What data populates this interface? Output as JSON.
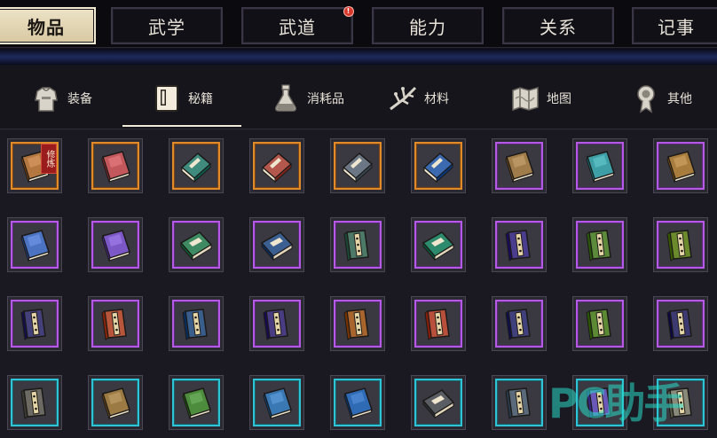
{
  "top_tabs": [
    {
      "label": "物品",
      "active": true
    },
    {
      "label": "武学",
      "active": false
    },
    {
      "label": "武道",
      "active": false,
      "badge": "!"
    },
    {
      "label": "能力",
      "active": false
    },
    {
      "label": "关系",
      "active": false
    },
    {
      "label": "记事",
      "active": false
    }
  ],
  "categories": [
    {
      "label": "装备",
      "icon": "armor-icon"
    },
    {
      "label": "秘籍",
      "icon": "manual-book-icon",
      "active": true
    },
    {
      "label": "消耗品",
      "icon": "potion-flask-icon"
    },
    {
      "label": "材料",
      "icon": "herb-material-icon"
    },
    {
      "label": "地图",
      "icon": "map-icon"
    },
    {
      "label": "其他",
      "icon": "misc-medal-icon"
    }
  ],
  "colors": {
    "orange": "#e08a2a",
    "purple": "#b45ae6",
    "cyan": "#2fc3d6"
  },
  "items": [
    [
      {
        "rarity": "orange",
        "book": "closed",
        "cover": "#b4773f",
        "tag": "修炼"
      },
      {
        "rarity": "orange",
        "book": "closed",
        "cover": "#c2585c"
      },
      {
        "rarity": "orange",
        "book": "angled",
        "cover": "#3f8b7e"
      },
      {
        "rarity": "orange",
        "book": "angled",
        "cover": "#b4574c"
      },
      {
        "rarity": "orange",
        "book": "angled",
        "cover": "#6b7785"
      },
      {
        "rarity": "orange",
        "book": "angled",
        "cover": "#3b6ab0"
      },
      {
        "rarity": "purple",
        "book": "closed",
        "cover": "#a07c4a"
      },
      {
        "rarity": "purple",
        "book": "closed",
        "cover": "#3ea0a6"
      },
      {
        "rarity": "purple",
        "book": "closed",
        "cover": "#a87c3c"
      }
    ],
    [
      {
        "rarity": "purple",
        "book": "closed",
        "cover": "#4c72c2"
      },
      {
        "rarity": "purple",
        "book": "closed",
        "cover": "#7c58c6"
      },
      {
        "rarity": "purple",
        "book": "flat",
        "cover": "#3e8a62"
      },
      {
        "rarity": "purple",
        "book": "flat",
        "cover": "#3c5f92"
      },
      {
        "rarity": "purple",
        "book": "spine",
        "cover": "#4d7a68"
      },
      {
        "rarity": "purple",
        "book": "flat",
        "cover": "#2e8a6c"
      },
      {
        "rarity": "purple",
        "book": "spine",
        "cover": "#4b3d8e"
      },
      {
        "rarity": "purple",
        "book": "spine",
        "cover": "#5a8a3a"
      },
      {
        "rarity": "purple",
        "book": "spine",
        "cover": "#6a8a2c"
      }
    ],
    [
      {
        "rarity": "purple",
        "book": "spine",
        "cover": "#44407a"
      },
      {
        "rarity": "purple",
        "book": "spine",
        "cover": "#b8563c"
      },
      {
        "rarity": "purple",
        "book": "spine",
        "cover": "#3a5e8c"
      },
      {
        "rarity": "purple",
        "book": "spine",
        "cover": "#4a3c82"
      },
      {
        "rarity": "purple",
        "book": "spine",
        "cover": "#a8652e"
      },
      {
        "rarity": "purple",
        "book": "spine",
        "cover": "#b8503c"
      },
      {
        "rarity": "purple",
        "book": "spine",
        "cover": "#40407c"
      },
      {
        "rarity": "purple",
        "book": "spine",
        "cover": "#5c8a34"
      },
      {
        "rarity": "purple",
        "book": "spine",
        "cover": "#3c3a70"
      }
    ],
    [
      {
        "rarity": "cyan",
        "book": "spine",
        "cover": "#6c6a62"
      },
      {
        "rarity": "cyan",
        "book": "closed",
        "cover": "#9c7a44"
      },
      {
        "rarity": "cyan",
        "book": "closed",
        "cover": "#4c8c3c"
      },
      {
        "rarity": "cyan",
        "book": "closed",
        "cover": "#3a78b4"
      },
      {
        "rarity": "cyan",
        "book": "closed",
        "cover": "#2f6ab4"
      },
      {
        "rarity": "cyan",
        "book": "flat",
        "cover": "#5a5e62"
      },
      {
        "rarity": "cyan",
        "book": "spine",
        "cover": "#5a6a7a"
      },
      {
        "rarity": "cyan",
        "book": "spine",
        "cover": "#6a58b8"
      },
      {
        "rarity": "cyan",
        "book": "spine",
        "cover": "#8a8a7a"
      }
    ]
  ],
  "watermark": "PC助手"
}
